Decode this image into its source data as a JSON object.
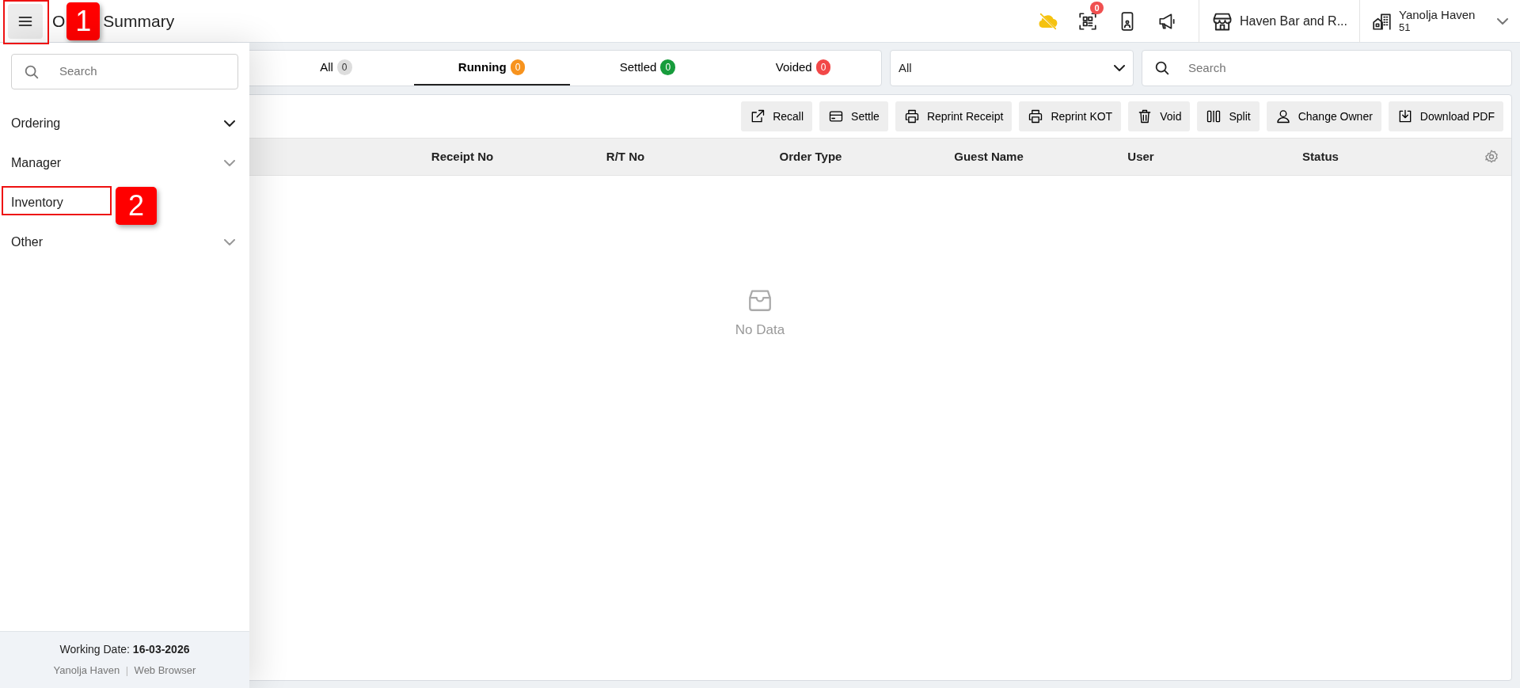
{
  "header": {
    "title_start": "O",
    "title_end": "Summary",
    "status_icons": [
      {
        "kind": "cloud"
      },
      {
        "kind": "qr",
        "badge": "0"
      },
      {
        "kind": "phone"
      },
      {
        "kind": "megaphone"
      }
    ],
    "outlet": "Haven Bar and R...",
    "property": {
      "name": "Yanolja Haven",
      "code": "51"
    }
  },
  "callouts": [
    "1",
    "2"
  ],
  "sidebar": {
    "search_placeholder": "Search",
    "items": [
      {
        "label": "Ordering",
        "kind": "group",
        "hovered": true
      },
      {
        "label": "Manager",
        "kind": "group",
        "hovered": false
      },
      {
        "label": "Inventory",
        "kind": "link"
      },
      {
        "label": "Other",
        "kind": "group",
        "hovered": false
      }
    ],
    "footer": {
      "date_label": "Working Date: ",
      "date": "16-03-2026",
      "user": "Yanolja Haven",
      "separator": "|",
      "client": "Web Browser"
    }
  },
  "tabs": [
    {
      "label": "All",
      "count": "0",
      "color": "#dddddd",
      "selected": false
    },
    {
      "label": "Running",
      "count": "0",
      "color": "#f7931e",
      "selected": true
    },
    {
      "label": "Settled",
      "count": "0",
      "color": "#179c3c",
      "selected": false
    },
    {
      "label": "Voided",
      "count": "0",
      "color": "#f24848",
      "selected": false
    }
  ],
  "filter": {
    "value": "All"
  },
  "search": {
    "placeholder": "Search"
  },
  "actions": [
    {
      "label": "Recall",
      "kind": "recall"
    },
    {
      "label": "Settle",
      "kind": "card"
    },
    {
      "label": "Reprint Receipt",
      "kind": "printer"
    },
    {
      "label": "Reprint KOT",
      "kind": "printer"
    },
    {
      "label": "Void",
      "kind": "trash"
    },
    {
      "label": "Split",
      "kind": "split"
    },
    {
      "label": "Change Owner",
      "kind": "person"
    },
    {
      "label": "Download PDF",
      "kind": "download"
    }
  ],
  "table": {
    "columns": [
      "Receipt No",
      "R/T No",
      "Order Type",
      "Guest Name",
      "User",
      "Status"
    ],
    "empty_text": "No Data"
  }
}
